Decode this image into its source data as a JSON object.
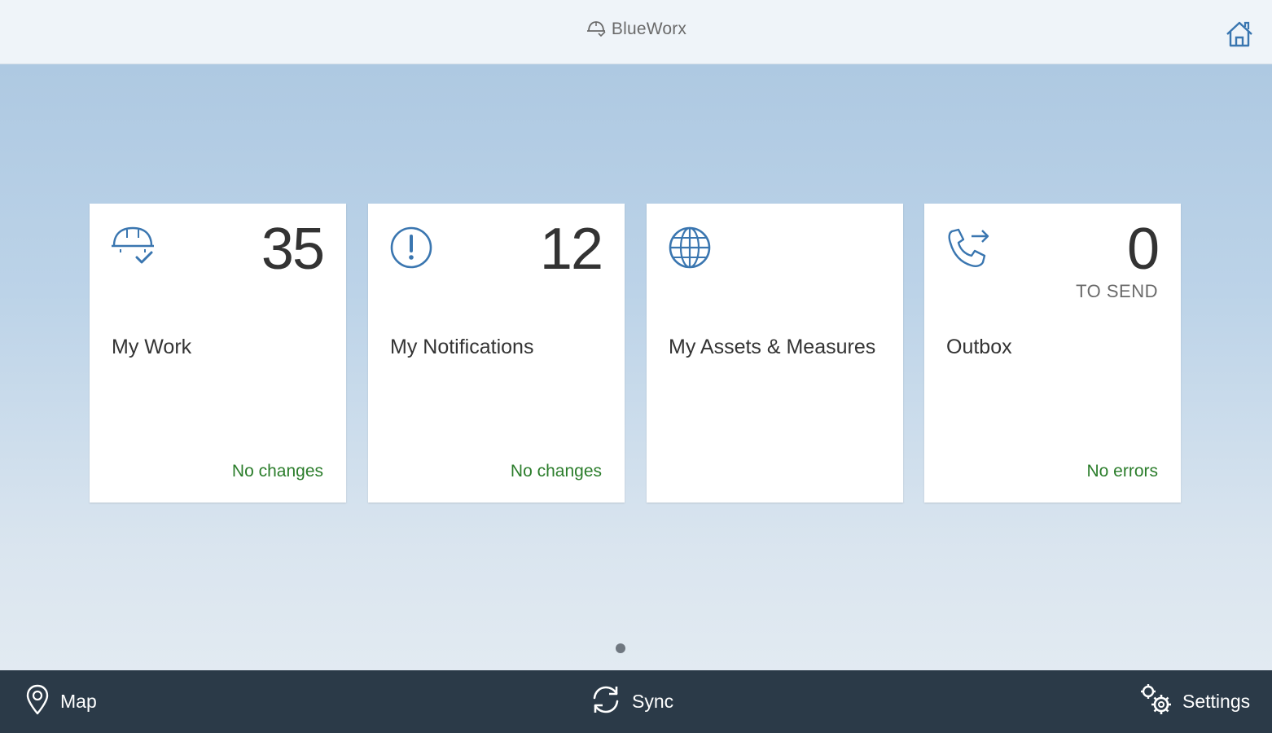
{
  "header": {
    "app_name": "BlueWorx",
    "brand_icon": "hard-hat-icon",
    "home_icon": "home-icon"
  },
  "tiles": [
    {
      "icon": "hard-hat-check-icon",
      "count": "35",
      "unit": "",
      "title": "My Work",
      "status": "No changes"
    },
    {
      "icon": "alert-circle-icon",
      "count": "12",
      "unit": "",
      "title": "My Notifications",
      "status": "No changes"
    },
    {
      "icon": "globe-icon",
      "count": "",
      "unit": "",
      "title": "My Assets & Measures",
      "status": ""
    },
    {
      "icon": "phone-forward-icon",
      "count": "0",
      "unit": "TO SEND",
      "title": "Outbox",
      "status": "No errors"
    }
  ],
  "pagination": {
    "pages": 1,
    "current": 1
  },
  "footer": {
    "map_label": "Map",
    "sync_label": "Sync",
    "settings_label": "Settings"
  },
  "colors": {
    "accent": "#3a76b0",
    "status_ok": "#2b7d2b",
    "footer_bg": "#2b3a48"
  }
}
